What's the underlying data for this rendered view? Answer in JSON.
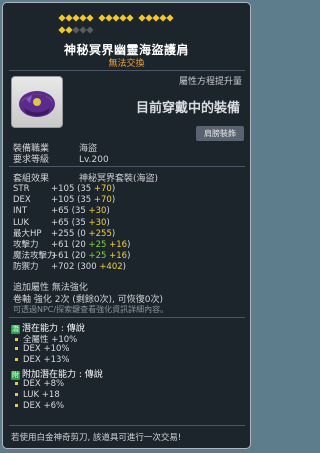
{
  "stars": {
    "row1": [
      5,
      5,
      5
    ],
    "row1_filled": 15,
    "row2_filled": 2,
    "row2_total": 5
  },
  "title": "神秘冥界幽靈海盜護肩",
  "subtitle": "無法交換",
  "compare_label": "屬性方程提升量",
  "equipped_label": "目前穿戴中的裝備",
  "badge": "肩膀裝飾",
  "job": {
    "label": "裝備職業",
    "value": "海盜"
  },
  "level": {
    "label": "要求等級",
    "value": "Lv.200"
  },
  "set": {
    "label": "套組效果",
    "value": "神秘冥界套裝(海盜)"
  },
  "stats": [
    {
      "k": "STR",
      "total": "+105",
      "base": "(35 ",
      "add1": "+70",
      "add1_color": "y",
      "tail": ")"
    },
    {
      "k": "DEX",
      "total": "+105",
      "base": "(35 ",
      "add1": "+70",
      "add1_color": "y",
      "tail": ")"
    },
    {
      "k": "INT",
      "total": "+65",
      "base": "(35 ",
      "add1": "+30",
      "add1_color": "y",
      "tail": ")"
    },
    {
      "k": "LUK",
      "total": "+65",
      "base": "(35 ",
      "add1": "+30",
      "add1_color": "y",
      "tail": ")"
    },
    {
      "k": "最大HP",
      "total": "+255",
      "base": "(0 ",
      "add1": "+255",
      "add1_color": "y",
      "tail": ")"
    },
    {
      "k": "攻擊力",
      "total": "+61",
      "base": "(20 ",
      "add1": "+25",
      "add1_color": "g",
      "add2": " +16",
      "add2_color": "y",
      "tail": ")"
    },
    {
      "k": "魔法攻擊力",
      "total": "+61",
      "base": "(20 ",
      "add1": "+25",
      "add1_color": "g",
      "add2": " +16",
      "add2_color": "y",
      "tail": ")"
    },
    {
      "k": "防禦力",
      "total": "+702",
      "base": "(300 ",
      "add1": "+402",
      "add1_color": "y",
      "tail": ")"
    }
  ],
  "extra": "追加屬性 無法強化",
  "scroll": "卷軸 強化 2次 (剩餘0次), 可恢復0次)",
  "npc_note": "可透過NPC/探索鍵查看強化資訊詳細內容。",
  "potential": {
    "head": "潛在能力 : 傳說",
    "lines": [
      "全屬性 +10%",
      "DEX +10%",
      "DEX +13%"
    ]
  },
  "add_potential": {
    "head": "附加潛在能力 : 傳說",
    "lines": [
      "DEX +8%",
      "LUK +18",
      "DEX +6%"
    ]
  },
  "footer": "若使用白金神奇剪刀, 該道具可進行一次交易!"
}
